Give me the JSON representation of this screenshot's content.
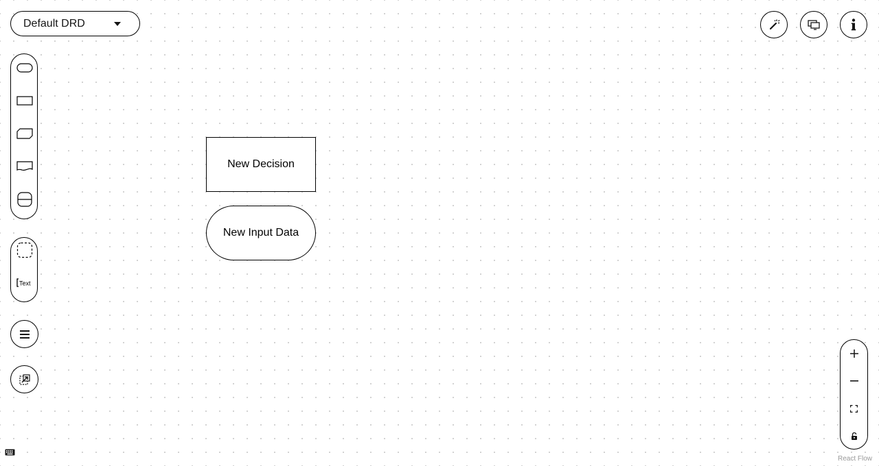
{
  "header": {
    "drd_selector": {
      "selected": "Default DRD",
      "icon": "caret-down-icon"
    }
  },
  "toolbar_right": [
    {
      "name": "auto-layout-button",
      "icon": "magic-wand-icon"
    },
    {
      "name": "overlays-button",
      "icon": "monitor-overlay-icon"
    },
    {
      "name": "info-button",
      "icon": "info-icon"
    }
  ],
  "palette": {
    "nodes": [
      {
        "name": "input-data-tool",
        "icon": "input-data-shape-icon"
      },
      {
        "name": "decision-tool",
        "icon": "decision-shape-icon"
      },
      {
        "name": "bkm-tool",
        "icon": "bkm-shape-icon"
      },
      {
        "name": "knowledge-source-tool",
        "icon": "knowledge-source-shape-icon"
      },
      {
        "name": "decision-service-tool",
        "icon": "decision-service-shape-icon"
      }
    ],
    "artifacts": [
      {
        "name": "group-tool",
        "icon": "group-shape-icon"
      },
      {
        "name": "text-annotation-tool",
        "icon": "text-annotation-icon",
        "label": "Text"
      }
    ],
    "extra": [
      {
        "name": "properties-button",
        "icon": "hamburger-menu-icon"
      },
      {
        "name": "external-nodes-button",
        "icon": "external-link-icon"
      }
    ]
  },
  "diagram": {
    "nodes": [
      {
        "type": "decision",
        "label": "New Decision"
      },
      {
        "type": "input-data",
        "label": "New Input Data"
      }
    ]
  },
  "zoom_controls": [
    {
      "name": "zoom-in-button",
      "icon": "plus-icon"
    },
    {
      "name": "zoom-out-button",
      "icon": "minus-icon"
    },
    {
      "name": "fit-view-button",
      "icon": "fit-view-icon"
    },
    {
      "name": "lock-button",
      "icon": "lock-icon"
    }
  ],
  "footer": {
    "attribution": "React Flow",
    "keyboard_icon": "keyboard-icon"
  }
}
